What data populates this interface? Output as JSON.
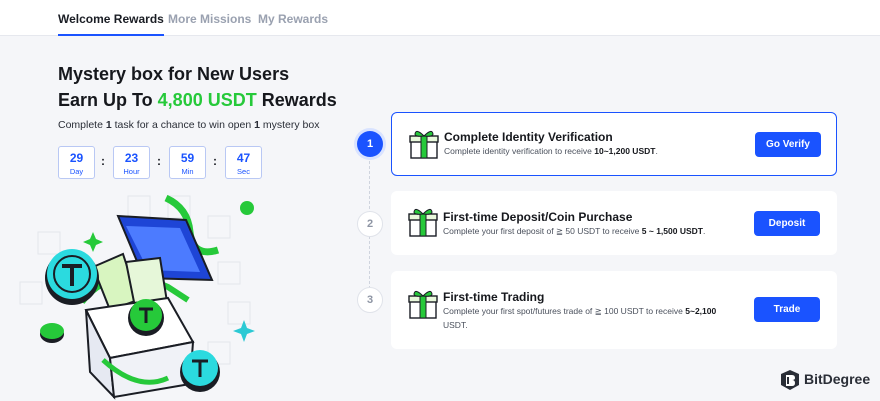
{
  "tabs": [
    {
      "label": "Welcome Rewards",
      "active": true
    },
    {
      "label": "More Missions",
      "active": false
    },
    {
      "label": "My Rewards",
      "active": false
    }
  ],
  "hero": {
    "title_line1": "Mystery box for New Users",
    "title_line2_prefix": "Earn Up To ",
    "title_line2_highlight": "4,800 USDT",
    "title_line2_suffix": " Rewards",
    "subtitle_prefix": "Complete ",
    "subtitle_count1": "1",
    "subtitle_middle": " task for a chance to win open ",
    "subtitle_count2": "1",
    "subtitle_suffix": " mystery box"
  },
  "countdown": [
    {
      "value": "29",
      "unit": "Day"
    },
    {
      "value": "23",
      "unit": "Hour"
    },
    {
      "value": "59",
      "unit": "Min"
    },
    {
      "value": "47",
      "unit": "Sec"
    }
  ],
  "countdown_separator": ":",
  "steps": [
    {
      "number": "1",
      "title": "Complete Identity Verification",
      "desc_prefix": "Complete identity verification to receive ",
      "desc_reward": "10~1,200 USDT",
      "desc_suffix": ".",
      "button": "Go Verify",
      "active": true
    },
    {
      "number": "2",
      "title": "First-time Deposit/Coin Purchase",
      "desc_prefix": "Complete your first deposit of ≧ 50 USDT to receive ",
      "desc_reward": "5 ~ 1,500 USDT",
      "desc_suffix": ".",
      "button": "Deposit",
      "active": false
    },
    {
      "number": "3",
      "title": "First-time Trading",
      "desc_prefix": "Complete your first spot/futures trade of ≧ 100 USDT to receive ",
      "desc_reward": "5~2,100",
      "desc_suffix": " USDT.",
      "button": "Trade",
      "active": false
    }
  ],
  "watermark": "BitDegree",
  "colors": {
    "accent": "#1a53ff",
    "highlight_green": "#26c93a",
    "background": "#f5f6f9",
    "card": "#ffffff"
  },
  "icons": {
    "card_icon": "gift-box-icon",
    "illustration": "mystery-box-illustration",
    "logo": "bitdegree-logo-icon"
  }
}
